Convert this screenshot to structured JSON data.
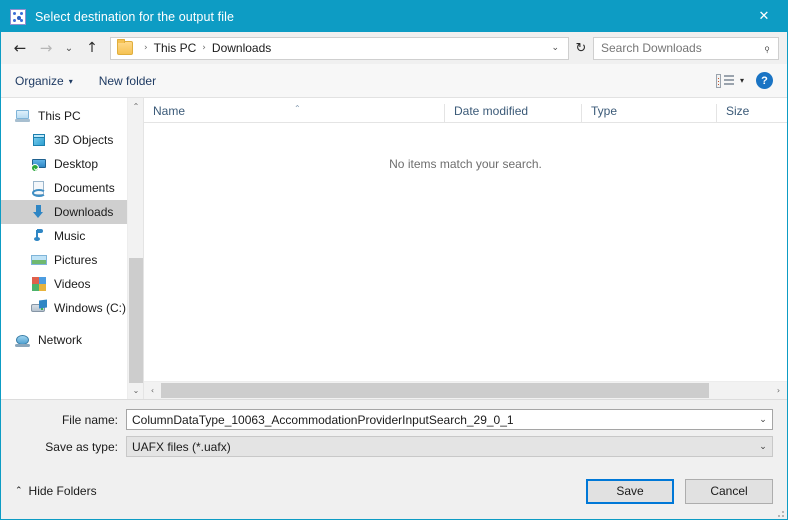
{
  "window": {
    "title": "Select destination for the output file",
    "title_icon": "app-icon",
    "close_label": "✕",
    "accent_color": "#0d9cc4"
  },
  "nav": {
    "back": "←",
    "forward": "→",
    "recent": "⌄",
    "up": "↑",
    "refresh": "↻",
    "breadcrumb": [
      "This PC",
      "Downloads"
    ],
    "breadcrumb_separator": "›",
    "address_caret": "⌄"
  },
  "search": {
    "placeholder": "Search Downloads",
    "icon": "⌕"
  },
  "command_bar": {
    "organize_label": "Organize",
    "organize_caret": "▾",
    "new_folder_label": "New folder",
    "view_caret": "▾",
    "help_label": "?"
  },
  "sidebar": {
    "items": [
      {
        "label": "This PC",
        "icon": "pc-icon",
        "indent": false,
        "selected": false
      },
      {
        "label": "3D Objects",
        "icon": "3d-objects-icon",
        "indent": true,
        "selected": false
      },
      {
        "label": "Desktop",
        "icon": "desktop-icon",
        "indent": true,
        "selected": false
      },
      {
        "label": "Documents",
        "icon": "documents-icon",
        "indent": true,
        "selected": false
      },
      {
        "label": "Downloads",
        "icon": "downloads-icon",
        "indent": true,
        "selected": true
      },
      {
        "label": "Music",
        "icon": "music-icon",
        "indent": true,
        "selected": false
      },
      {
        "label": "Pictures",
        "icon": "pictures-icon",
        "indent": true,
        "selected": false
      },
      {
        "label": "Videos",
        "icon": "videos-icon",
        "indent": true,
        "selected": false
      },
      {
        "label": "Windows (C:)",
        "icon": "drive-icon",
        "indent": true,
        "selected": false
      },
      {
        "label": "Network",
        "icon": "network-icon",
        "indent": false,
        "selected": false
      }
    ],
    "scroll_up": "⌃",
    "scroll_down": "⌄"
  },
  "filelist": {
    "columns": [
      {
        "label": "Name"
      },
      {
        "label": "Date modified"
      },
      {
        "label": "Type"
      },
      {
        "label": "Size"
      }
    ],
    "sort_indicator": "⌃",
    "empty_message": "No items match your search.",
    "rows": [],
    "hscroll_left": "‹",
    "hscroll_right": "›"
  },
  "form": {
    "file_name_label": "File name:",
    "file_name_value": "ColumnDataType_10063_AccommodationProviderInputSearch_29_0_1",
    "save_as_type_label": "Save as type:",
    "save_as_type_value": "UAFX files (*.uafx)",
    "caret": "⌄"
  },
  "footer": {
    "hide_folders_label": "Hide Folders",
    "hide_folders_chevron": "⌃",
    "save_label": "Save",
    "cancel_label": "Cancel"
  }
}
